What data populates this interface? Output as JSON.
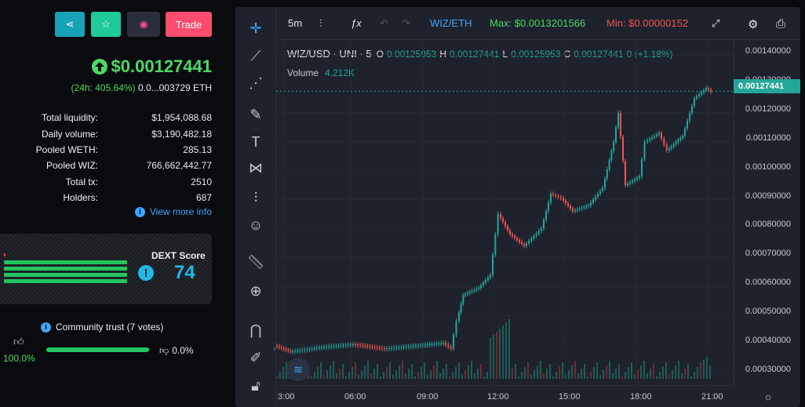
{
  "header": {
    "trade_label": "Trade"
  },
  "token": {
    "price": "$0.00127441",
    "change_24h": "(24h: 405.64%)",
    "eth_price": "0.0...003729 ETH"
  },
  "stats": [
    {
      "label": "Total liquidity:",
      "value": "$1,954,088.68"
    },
    {
      "label": "Daily volume:",
      "value": "$3,190,482.18"
    },
    {
      "label": "Pooled WETH:",
      "value": "285.13"
    },
    {
      "label": "Pooled WIZ:",
      "value": "766,662,442.77"
    },
    {
      "label": "Total tx:",
      "value": "2510"
    },
    {
      "label": "Holders:",
      "value": "687"
    }
  ],
  "view_more": "View more info",
  "dext": {
    "title": "DEXT Score",
    "score": "74"
  },
  "community": {
    "title": "Community trust (7 votes)",
    "up_pct": "100.0%",
    "down_pct": "0.0%",
    "up_fraction": 1.0
  },
  "chart": {
    "interval": "5m",
    "pair": "WIZ/ETH",
    "max": "Max: $0.0013201566",
    "min": "Min: $0.00000152",
    "symbol": "WIZ/USD · UNI · 5",
    "ohlc": {
      "o_label": "O",
      "o": "0.00125953",
      "h_label": "H",
      "h": "0.00127441",
      "l_label": "L",
      "l": "0.00125953",
      "c_label": "C",
      "c": "0.00127441",
      "change": "0 (+1.18%)"
    },
    "volume_label": "Volume",
    "volume": "4.212K",
    "last_price": "0.00127441",
    "y_ticks": [
      "0.00140000",
      "0.00130000",
      "0.00120000",
      "0.00110000",
      "0.00100000",
      "0.00090000",
      "0.00080000",
      "0.00070000",
      "0.00060000",
      "0.00050000",
      "0.00040000",
      "0.00030000"
    ],
    "x_ticks": [
      "3:00",
      "06:00",
      "09:00",
      "12:00",
      "15:00",
      "18:00",
      "21:00"
    ]
  },
  "colors": {
    "up": "#26a69a",
    "down": "#ef5350",
    "accent_green": "#4cd964",
    "share_btn": "#17a2b8",
    "star_btn": "#20c997",
    "trade_btn": "#ff4b6e"
  }
}
